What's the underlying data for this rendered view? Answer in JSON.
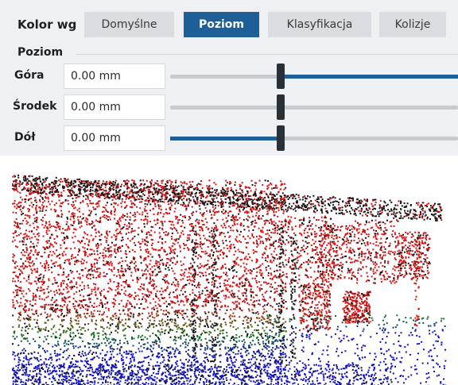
{
  "toolbar": {
    "color_by_label": "Kolor wg",
    "modes": [
      {
        "label": "Domyślne",
        "active": false
      },
      {
        "label": "Poziom",
        "active": true
      },
      {
        "label": "Klasyfikacja",
        "active": false
      },
      {
        "label": "Kolizje",
        "active": false
      }
    ]
  },
  "level_panel": {
    "title": "Poziom",
    "rows": [
      {
        "label": "Góra",
        "value": "0.00 mm",
        "fill": "right"
      },
      {
        "label": "Środek",
        "value": "0.00 mm",
        "fill": "none"
      },
      {
        "label": "Dół",
        "value": "0.00 mm",
        "fill": "left"
      }
    ]
  },
  "colors": {
    "accent": "#1d5f96",
    "cloud_high": "#d61414",
    "cloud_mid": "#1a7a1a",
    "cloud_low": "#1010c8",
    "cloud_dark": "#141414"
  }
}
